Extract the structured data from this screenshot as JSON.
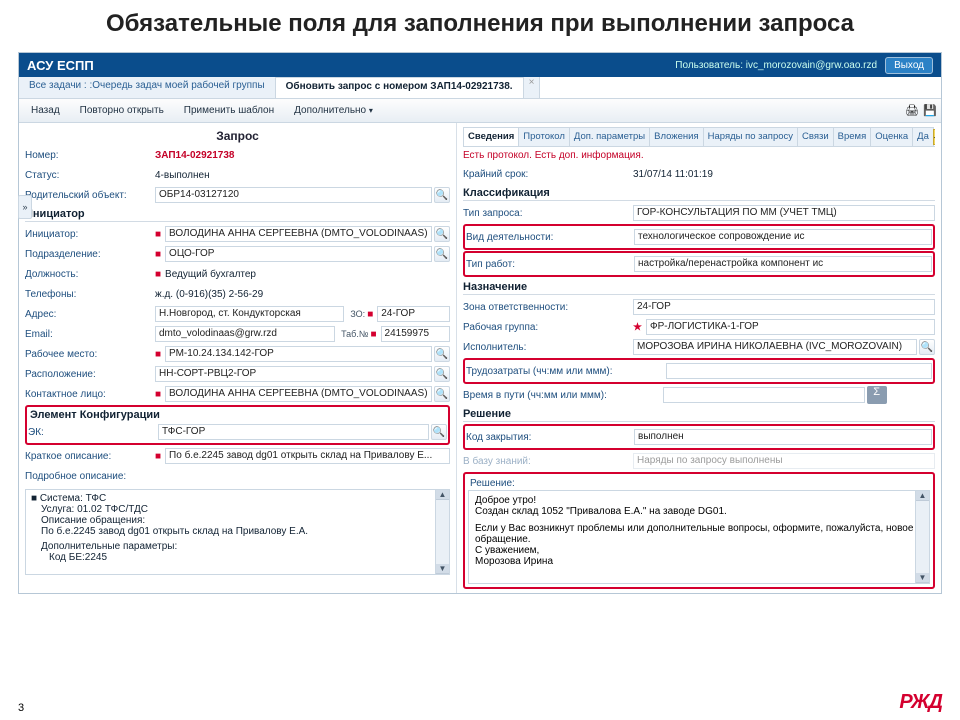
{
  "slide_title": "Обязательные поля для заполнения при выполнении запроса",
  "topbar": {
    "brand": "АСУ ЕСПП",
    "user_prefix": "Пользователь:",
    "user": "ivc_morozovain@grw.oao.rzd",
    "exit": "Выход"
  },
  "breadcrumb": {
    "all": "Все задачи :",
    "queue": ":Очередь задач моей рабочей группы",
    "active": "Обновить запрос с номером ЗАП14-02921738."
  },
  "toolbar": {
    "back": "Назад",
    "reopen": "Повторно открыть",
    "template": "Применить шаблон",
    "more": "Дополнительно"
  },
  "left": {
    "title": "Запрос",
    "number_lab": "Номер:",
    "number": "ЗАП14-02921738",
    "status_lab": "Статус:",
    "status": "4-выполнен",
    "parent_lab": "Родительский объект:",
    "parent": "ОБР14-03127120",
    "initiator_head": "Инициатор",
    "initiator_lab": "Инициатор:",
    "initiator": "ВОЛОДИНА АННА СЕРГЕЕВНА (DMTO_VOLODINAAS)",
    "unit_lab": "Подразделение:",
    "unit": "ОЦО-ГОР",
    "position_lab": "Должность:",
    "position": "Ведущий бухгалтер",
    "phones_lab": "Телефоны:",
    "phones": "ж.д. (0-916)(35) 2-56-29",
    "address_lab": "Адрес:",
    "address": "Н.Новгород, ст. Кондукторская",
    "zo_lab": "ЗО:",
    "zo": "24-ГОР",
    "email_lab": "Email:",
    "email": "dmto_volodinaas@grw.rzd",
    "tab_lab": "Таб.№",
    "tab": "24159975",
    "workplace_lab": "Рабочее место:",
    "workplace": "РМ-10.24.134.142-ГОР",
    "location_lab": "Расположение:",
    "location": "НН-СОРТ-РВЦ2-ГОР",
    "contact_lab": "Контактное лицо:",
    "contact": "ВОЛОДИНА АННА СЕРГЕЕВНА (DMTO_VOLODINAAS)",
    "config_head": "Элемент Конфигурации",
    "ek_lab": "ЭК:",
    "ek": "ТФС-ГОР",
    "brief_lab": "Краткое описание:",
    "brief": "По б.е.2245 завод dg01 открыть склад  на Привалову Е...",
    "full_lab": "Подробное описание:",
    "desc1": "Система: ТФС",
    "desc2": "Услуга: 01.02 ТФС/ТДС",
    "desc3": "Описание обращения:",
    "desc4": "По б.е.2245 завод dg01 открыть склад на Привалову Е.А.",
    "desc5": "Дополнительные параметры:",
    "desc6": "Код БЕ:2245"
  },
  "tabs": {
    "t1": "Сведения",
    "t2": "Протокол",
    "t3": "Доп. параметры",
    "t4": "Вложения",
    "t5": "Наряды по запросу",
    "t6": "Связи",
    "t7": "Время",
    "t8": "Оценка",
    "t9": "Да"
  },
  "right": {
    "warn": "Есть протокол. Есть доп. информация.",
    "deadline_lab": "Крайний срок:",
    "deadline": "31/07/14 11:01:19",
    "class_head": "Классификация",
    "reqtype_lab": "Тип запроса:",
    "reqtype": "ГОР-КОНСУЛЬТАЦИЯ ПО ММ (УЧЕТ ТМЦ)",
    "activity_lab": "Вид деятельности:",
    "activity": "технологическое сопровождение ис",
    "worktype_lab": "Тип работ:",
    "worktype": "настройка/перенастройка компонент ис",
    "assign_head": "Назначение",
    "zone_lab": "Зона ответственности:",
    "zone": "24-ГОР",
    "group_lab": "Рабочая группа:",
    "group": "ФР-ЛОГИСТИКА-1-ГОР",
    "exec_lab": "Исполнитель:",
    "exec": "МОРОЗОВА ИРИНА НИКОЛАЕВНА (IVC_MOROZOVAIN)",
    "labor_lab": "Трудозатраты (чч:мм или ммм):",
    "travel_lab": "Время в пути (чч:мм или ммм):",
    "solution_head": "Решение",
    "closecode_lab": "Код закрытия:",
    "closecode": "выполнен",
    "kb_lab": "В базу знаний:",
    "kb_val": "Наряды по запросу выполнены",
    "solution_lab": "Решение:",
    "sol1": "Доброе утро!",
    "sol2": "Создан склад 1052 \"Привалова Е.А.\" на заводе DG01.",
    "sol3": "Если у Вас возникнут проблемы или дополнительные вопросы, оформите, пожалуйста, новое обращение.",
    "sol4": "С уважением,",
    "sol5": "Морозова Ирина"
  },
  "footer": {
    "page": "3",
    "logo": "РЖД"
  }
}
